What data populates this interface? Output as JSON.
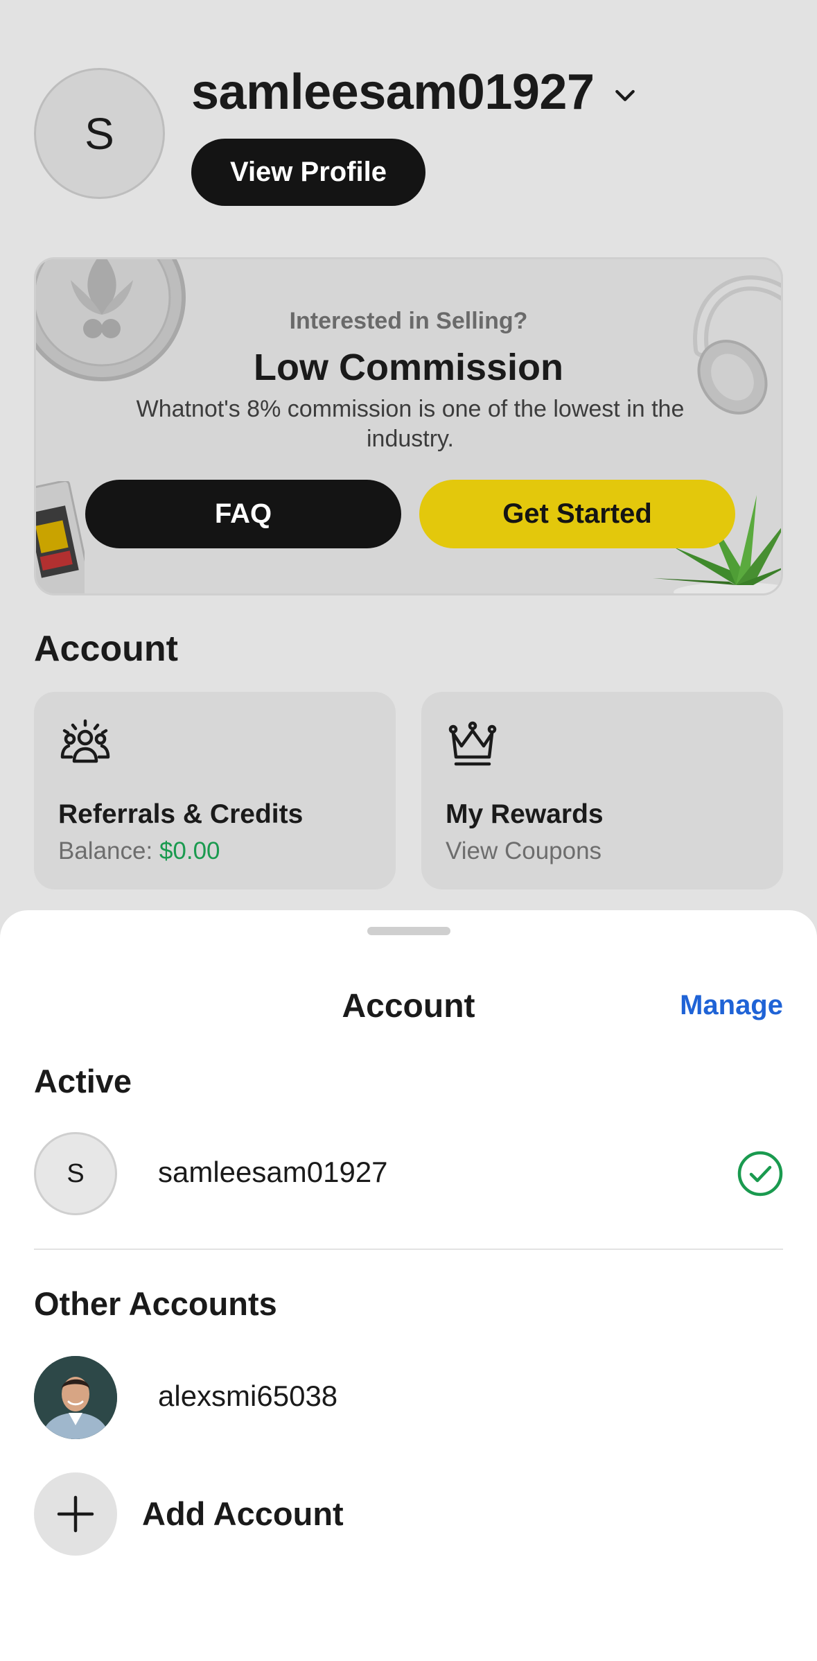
{
  "header": {
    "avatar_initial": "S",
    "username": "samleesam01927",
    "view_profile_label": "View Profile"
  },
  "promo": {
    "kicker": "Interested in Selling?",
    "title": "Low Commission",
    "description": "Whatnot's 8% commission is one of the lowest in the industry.",
    "faq_label": "FAQ",
    "get_started_label": "Get Started",
    "accent_color": "#e3c80c"
  },
  "account": {
    "section_title": "Account",
    "tiles": [
      {
        "icon": "referrals-icon",
        "title": "Referrals & Credits",
        "subtitle_prefix": "Balance: ",
        "subtitle_value": "$0.00"
      },
      {
        "icon": "crown-icon",
        "title": "My Rewards",
        "subtitle": "View Coupons"
      }
    ]
  },
  "sheet": {
    "title": "Account",
    "manage_label": "Manage",
    "active_label": "Active",
    "active_account": {
      "initial": "S",
      "username": "samleesam01927",
      "status_icon": "check-circle-icon"
    },
    "other_label": "Other Accounts",
    "other_accounts": [
      {
        "username": "alexsmi65038",
        "avatar": "photo"
      }
    ],
    "add_account_label": "Add Account"
  },
  "colors": {
    "link": "#1f63d6",
    "success": "#1a9a4f",
    "dark_button": "#141414"
  }
}
